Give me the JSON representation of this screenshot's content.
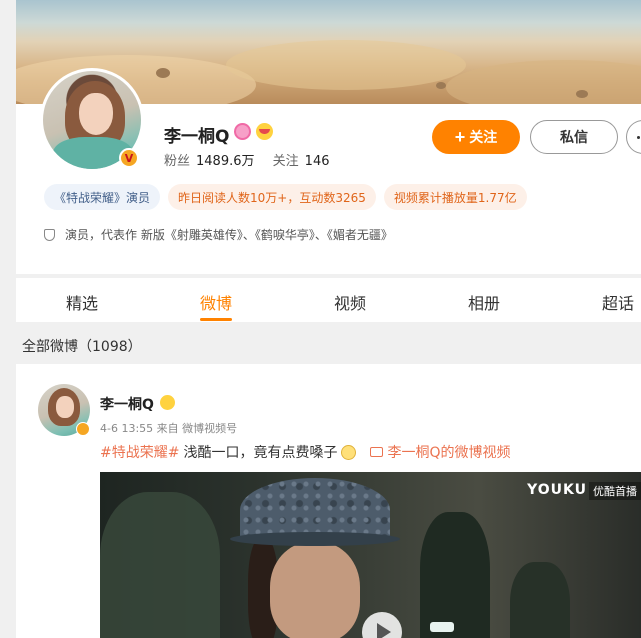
{
  "profile": {
    "name": "李一桐Q",
    "fans_label": "粉丝",
    "fans_count": "1489.6万",
    "following_label": "关注",
    "following_count": "146",
    "follow_button": "关注",
    "message_button": "私信",
    "tags": [
      "《特战荣耀》演员",
      "昨日阅读人数10万+，互动数3265",
      "视频累计播放量1.77亿"
    ],
    "description": "演员，代表作 新版《射雕英雄传》、《鹤唳华亭》、《媚者无疆》"
  },
  "tabs": [
    "精选",
    "微博",
    "视频",
    "相册",
    "超话"
  ],
  "active_tab": "微博",
  "post_count_label": "全部微博（1098）",
  "post": {
    "author": "李一桐Q",
    "time": "4-6 13:55",
    "source": "来自 微博视频号",
    "hashtag": "#特战荣耀#",
    "text": "浅酷一口，竟有点费嗓子",
    "video_link": "李一桐Q的微博视频",
    "video_watermark": "YOUKU",
    "video_tag": "优酷首播"
  },
  "colors": {
    "accent": "#ff8200",
    "link": "#eb7350",
    "tag_blue": "#43608a",
    "tag_orange": "#e0651a"
  },
  "icons": {
    "verified": "verified-badge-icon",
    "level": "level-icon",
    "fan_club": "fan-emoji-icon",
    "more": "more-dots-icon",
    "shield": "shield-icon",
    "video": "video-icon",
    "play": "play-icon"
  }
}
